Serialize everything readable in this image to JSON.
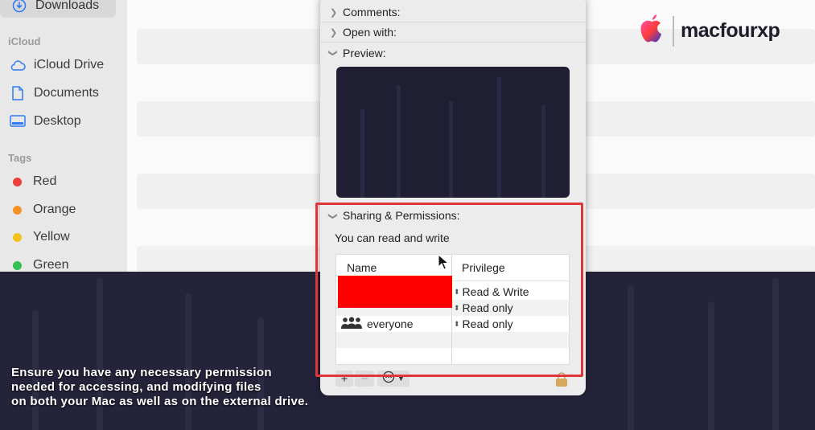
{
  "sidebar": {
    "downloads": "Downloads",
    "icloud_header": "iCloud",
    "icloud_drive": "iCloud Drive",
    "documents": "Documents",
    "desktop": "Desktop",
    "tags_header": "Tags",
    "tags": [
      {
        "label": "Red",
        "color": "#ee3d3a"
      },
      {
        "label": "Orange",
        "color": "#f39325"
      },
      {
        "label": "Yellow",
        "color": "#f3c21a"
      },
      {
        "label": "Green",
        "color": "#33c151"
      }
    ]
  },
  "panel": {
    "sections": {
      "comments": "Comments:",
      "open_with": "Open with:",
      "preview": "Preview:"
    },
    "sharing": {
      "title": "Sharing & Permissions:",
      "status": "You can read and write",
      "col_name": "Name",
      "col_privilege": "Privilege",
      "rows": [
        {
          "name": "",
          "privilege": "Read & Write"
        },
        {
          "name": "",
          "privilege": "Read only"
        },
        {
          "name": "everyone",
          "privilege": "Read only"
        }
      ]
    },
    "toolbar": {
      "add": "+",
      "remove": "−"
    }
  },
  "caption": {
    "line1": "Ensure you have any necessary permission",
    "line2": "needed for accessing, and modifying files",
    "line3": "on both your Mac as well as on the external drive."
  },
  "logo": {
    "text": "macfourxp"
  },
  "colors": {
    "highlight": "#e0363a",
    "redaction": "#ff0000"
  }
}
